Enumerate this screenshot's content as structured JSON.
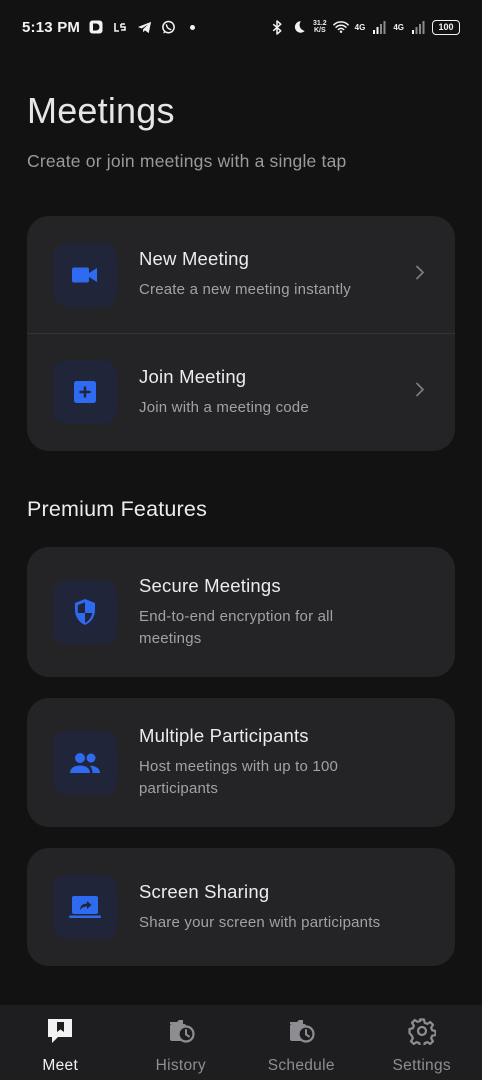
{
  "status_bar": {
    "time": "5:13 PM",
    "net_speed": "31.2",
    "net_speed_unit": "K/S",
    "network_1": "4G",
    "network_2": "4G",
    "battery": "100"
  },
  "header": {
    "title": "Meetings",
    "subtitle": "Create or join meetings with a single tap"
  },
  "actions": [
    {
      "title": "New Meeting",
      "description": "Create a new meeting instantly",
      "icon": "video-camera-icon"
    },
    {
      "title": "Join Meeting",
      "description": "Join with a meeting code",
      "icon": "add-box-icon"
    }
  ],
  "premium": {
    "section_title": "Premium Features",
    "features": [
      {
        "title": "Secure Meetings",
        "description_line1": "End-to-end encryption for all",
        "description_line2": "meetings",
        "icon": "shield-icon"
      },
      {
        "title": "Multiple Participants",
        "description_line1": "Host meetings with up to 100",
        "description_line2": "participants",
        "icon": "people-icon"
      },
      {
        "title": "Screen Sharing",
        "description_line1": "Share your screen with participants",
        "icon": "screen-share-icon"
      }
    ]
  },
  "bottom_nav": {
    "active": "Meet",
    "items": [
      {
        "label": "Meet",
        "icon": "bookmark-icon"
      },
      {
        "label": "History",
        "icon": "history-icon"
      },
      {
        "label": "Schedule",
        "icon": "schedule-icon"
      },
      {
        "label": "Settings",
        "icon": "gear-icon"
      }
    ]
  },
  "colors": {
    "background": "#121212",
    "card": "#242426",
    "icon_tile": "#20253a",
    "accent": "#2f6bf0",
    "nav_bar": "#1e1e20"
  }
}
